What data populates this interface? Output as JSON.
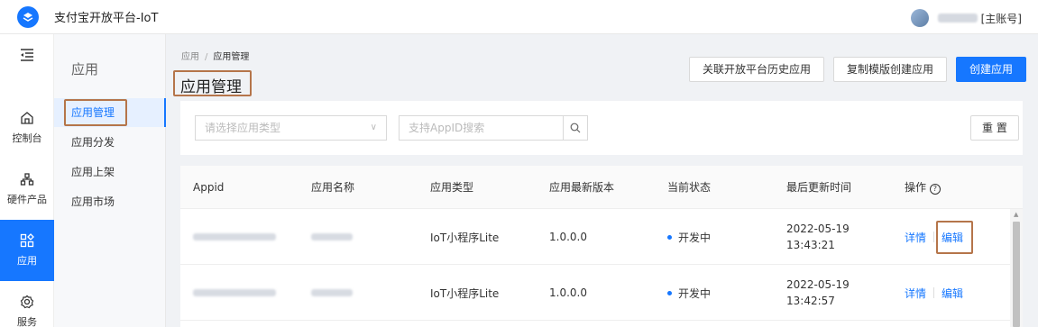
{
  "header": {
    "title": "支付宝开放平台-IoT",
    "account_tag": "[主账号]"
  },
  "rail": {
    "items": [
      {
        "label": "控制台",
        "icon": "home-icon"
      },
      {
        "label": "硬件产品",
        "icon": "hardware-icon"
      },
      {
        "label": "应用",
        "icon": "apps-icon",
        "active": true
      },
      {
        "label": "服务",
        "icon": "service-icon"
      }
    ]
  },
  "subnav": {
    "title": "应用",
    "items": [
      {
        "label": "应用管理",
        "active": true
      },
      {
        "label": "应用分发"
      },
      {
        "label": "应用上架"
      },
      {
        "label": "应用市场"
      }
    ]
  },
  "main": {
    "breadcrumb": {
      "root": "应用",
      "sep": "/",
      "current": "应用管理"
    },
    "page_title": "应用管理",
    "actions": {
      "link_history": "关联开放平台历史应用",
      "copy_template": "复制模版创建应用",
      "create": "创建应用"
    },
    "filter": {
      "type_placeholder": "请选择应用类型",
      "search_placeholder": "支持AppID搜索",
      "reset": "重 置"
    },
    "table": {
      "columns": [
        "Appid",
        "应用名称",
        "应用类型",
        "应用最新版本",
        "当前状态",
        "最后更新时间",
        "操作"
      ],
      "rows": [
        {
          "type": "IoT小程序Lite",
          "version": "1.0.0.0",
          "status": "开发中",
          "date": "2022-05-19",
          "time": "13:43:21",
          "detail": "详情",
          "edit": "编辑"
        },
        {
          "type": "IoT小程序Lite",
          "version": "1.0.0.0",
          "status": "开发中",
          "date": "2022-05-19",
          "time": "13:42:57",
          "detail": "详情",
          "edit": "编辑"
        }
      ]
    }
  },
  "colors": {
    "accent": "#1677ff",
    "highlight_box": "#b5754a"
  }
}
